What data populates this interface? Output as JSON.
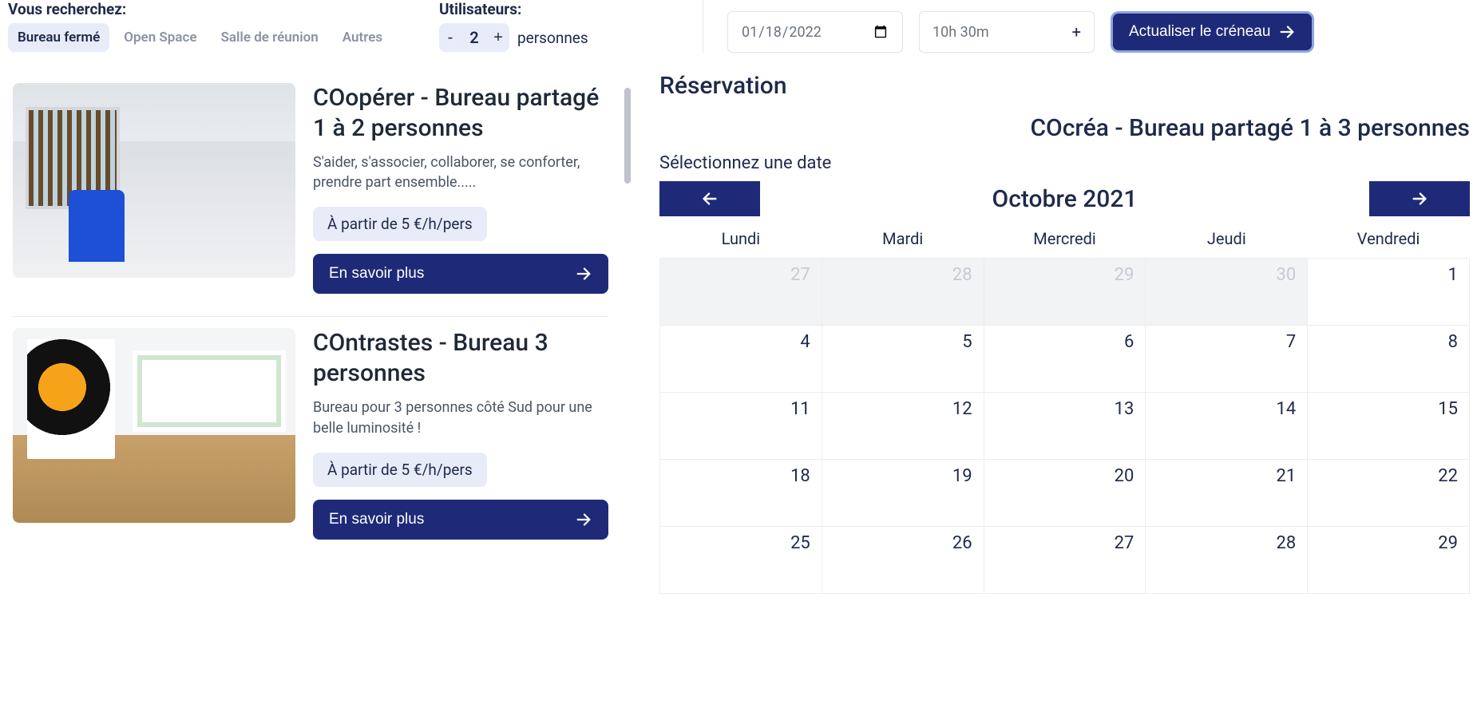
{
  "search": {
    "heading": "Vous recherchez:",
    "tabs": [
      "Bureau fermé",
      "Open Space",
      "Salle de réunion",
      "Autres"
    ],
    "active_tab": 0
  },
  "users": {
    "heading": "Utilisateurs:",
    "count": "2",
    "unit": "personnes"
  },
  "date": {
    "value": "2022-01-18"
  },
  "duration": {
    "value": "10h 30m"
  },
  "update_button": "Actualiser le créneau",
  "listings": [
    {
      "title": "COopérer - Bureau partagé 1 à 2 personnes",
      "desc": "S'aider, s'associer, collaborer, se conforter, prendre part ensemble.....",
      "price": "À partir de 5 €/h/pers",
      "more": "En savoir plus"
    },
    {
      "title": "COntrastes - Bureau 3 personnes",
      "desc": "Bureau pour 3 personnes côté Sud pour une belle luminosité !",
      "price": "À partir de 5 €/h/pers",
      "more": "En savoir plus"
    }
  ],
  "reservation": {
    "heading": "Réservation",
    "selected_room": "COcréa - Bureau partagé 1 à 3 personnes",
    "select_date_label": "Sélectionnez une date",
    "month": "Octobre 2021",
    "weekdays": [
      "Lundi",
      "Mardi",
      "Mercredi",
      "Jeudi",
      "Vendredi"
    ],
    "weeks": [
      [
        {
          "d": "27",
          "muted": true
        },
        {
          "d": "28",
          "muted": true
        },
        {
          "d": "29",
          "muted": true
        },
        {
          "d": "30",
          "muted": true
        },
        {
          "d": "1",
          "muted": false
        }
      ],
      [
        {
          "d": "4"
        },
        {
          "d": "5"
        },
        {
          "d": "6"
        },
        {
          "d": "7"
        },
        {
          "d": "8"
        }
      ],
      [
        {
          "d": "11"
        },
        {
          "d": "12"
        },
        {
          "d": "13"
        },
        {
          "d": "14"
        },
        {
          "d": "15"
        }
      ],
      [
        {
          "d": "18"
        },
        {
          "d": "19"
        },
        {
          "d": "20"
        },
        {
          "d": "21"
        },
        {
          "d": "22"
        }
      ],
      [
        {
          "d": "25"
        },
        {
          "d": "26"
        },
        {
          "d": "27"
        },
        {
          "d": "28"
        },
        {
          "d": "29"
        }
      ]
    ]
  }
}
